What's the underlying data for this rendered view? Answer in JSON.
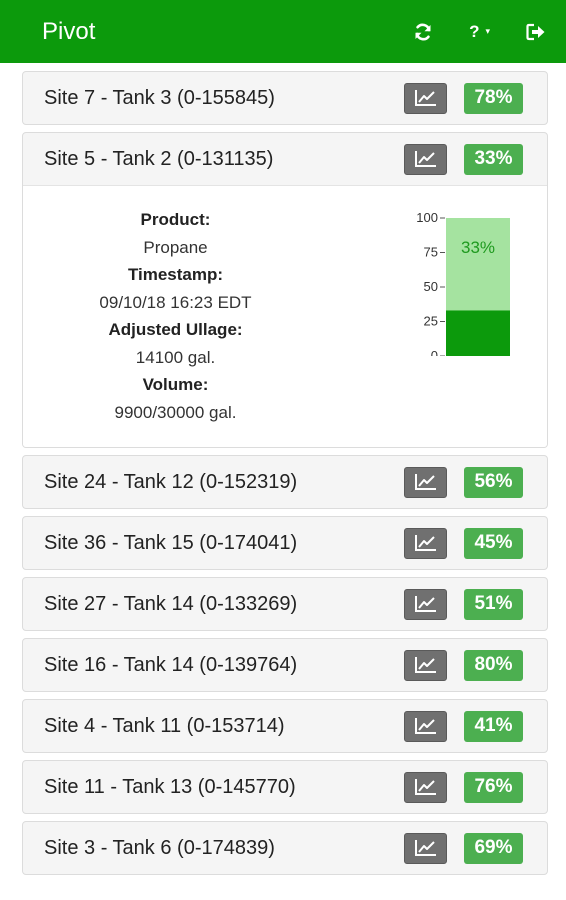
{
  "app": {
    "title": "Pivot"
  },
  "nav": {
    "refresh_icon": "refresh-icon",
    "help_label": "?",
    "help_caret": "▾",
    "logout_icon": "sign-out-icon"
  },
  "colors": {
    "navbar": "#0c9a0c",
    "badge": "#4caf50",
    "chart_button": "#707070",
    "gauge_fill": "#0c9a0c",
    "gauge_empty": "#a5e3a0"
  },
  "tanks": [
    {
      "title": "Site 7 - Tank 3 (0-155845)",
      "percent": "78%"
    },
    {
      "title": "Site 5 - Tank 2 (0-131135)",
      "percent": "33%"
    },
    {
      "title": "Site 24 - Tank 12 (0-152319)",
      "percent": "56%"
    },
    {
      "title": "Site 36 - Tank 15 (0-174041)",
      "percent": "45%"
    },
    {
      "title": "Site 27 - Tank 14 (0-133269)",
      "percent": "51%"
    },
    {
      "title": "Site 16 - Tank 14 (0-139764)",
      "percent": "80%"
    },
    {
      "title": "Site 4 - Tank 11 (0-153714)",
      "percent": "41%"
    },
    {
      "title": "Site 11 - Tank 13 (0-145770)",
      "percent": "76%"
    },
    {
      "title": "Site 3 - Tank 6 (0-174839)",
      "percent": "69%"
    }
  ],
  "detail": {
    "product_label": "Product:",
    "product_value": "Propane",
    "timestamp_label": "Timestamp:",
    "timestamp_value": "09/10/18 16:23 EDT",
    "ullage_label": "Adjusted Ullage:",
    "ullage_value": "14100 gal.",
    "volume_label": "Volume:",
    "volume_value": "9900/30000 gal."
  },
  "chart_data": {
    "type": "bar",
    "categories": [
      ""
    ],
    "values": [
      33
    ],
    "data_label": "33%",
    "ylim": [
      0,
      100
    ],
    "ytick_labels": [
      "100",
      "75",
      "50",
      "25",
      "0"
    ],
    "title": "",
    "xlabel": "",
    "ylabel": ""
  }
}
